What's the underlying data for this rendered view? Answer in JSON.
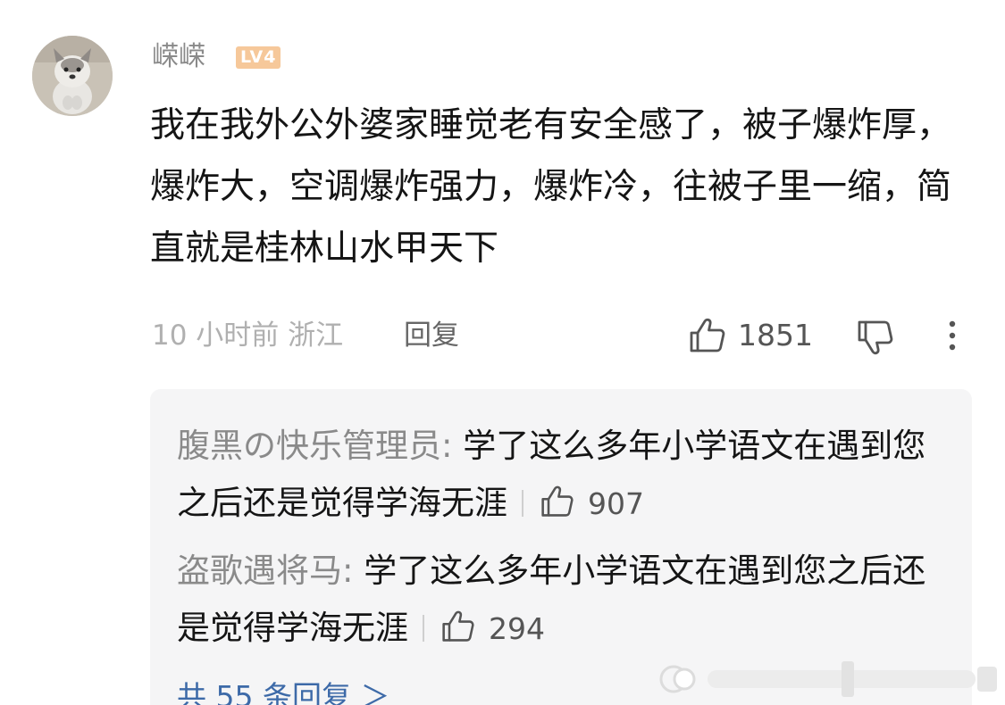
{
  "comment": {
    "username": "嵘嵘",
    "level_badge": "LV4",
    "text": "我在我外公外婆家睡觉老有安全感了，被子爆炸厚，爆炸大，空调爆炸强力，爆炸冷，往被子里一缩，简直就是桂林山水甲天下",
    "time_location": "10 小时前 浙江",
    "reply_label": "回复",
    "like_count": "1851"
  },
  "replies": [
    {
      "author": "腹黑の快乐管理员:",
      "text": " 学了这么多年小学语文在遇到您之后还是觉得学海无涯",
      "like_count": "907"
    },
    {
      "author": "盗歌遇将马:",
      "text": " 学了这么多年小学语文在遇到您之后还是觉得学海无涯",
      "like_count": "294"
    }
  ],
  "view_all_replies": "共 55 条回复 ＞",
  "icons": {
    "like": "thumbs-up-icon",
    "dislike": "thumbs-down-icon",
    "more": "more-vertical-icon"
  },
  "colors": {
    "username": "#8a8a8a",
    "level_badge": "#f6c89a",
    "link": "#3d6aa8",
    "reply_box": "#f5f5f6"
  }
}
